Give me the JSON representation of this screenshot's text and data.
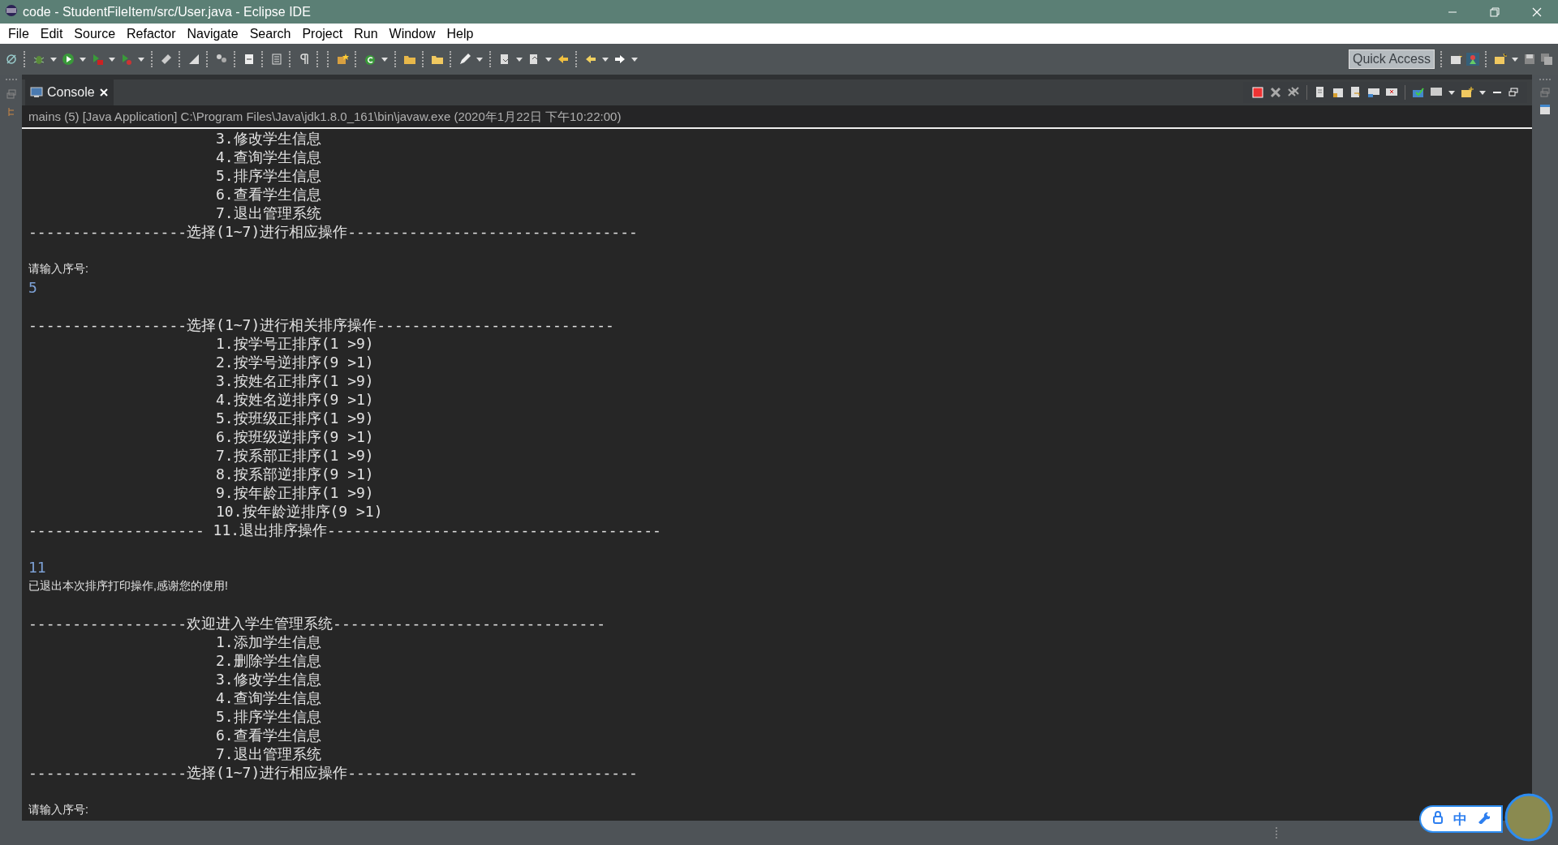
{
  "window": {
    "title": "code - StudentFileItem/src/User.java - Eclipse IDE"
  },
  "menu": [
    "File",
    "Edit",
    "Source",
    "Refactor",
    "Navigate",
    "Search",
    "Project",
    "Run",
    "Window",
    "Help"
  ],
  "quick_access": {
    "placeholder": "Quick Access"
  },
  "console": {
    "tab": {
      "label": "Console",
      "selected": true
    },
    "header": "mains (5) [Java Application] C:\\Program Files\\Java\\jdk1.8.0_161\\bin\\javaw.exe (2020年1月22日 下午10:22:00)",
    "lines": [
      {
        "kind": "item",
        "text": "3.修改学生信息"
      },
      {
        "kind": "item",
        "text": "4.查询学生信息"
      },
      {
        "kind": "item",
        "text": "5.排序学生信息"
      },
      {
        "kind": "item",
        "text": "6.查看学生信息"
      },
      {
        "kind": "item",
        "text": "7.退出管理系统"
      },
      {
        "kind": "rule",
        "text": "------------------选择(1~7)进行相应操作---------------------------------"
      },
      {
        "kind": "blank"
      },
      {
        "kind": "prompt",
        "text": "请输入序号:"
      },
      {
        "kind": "input",
        "text": "5"
      },
      {
        "kind": "blank"
      },
      {
        "kind": "rule",
        "text": "------------------选择(1~7)进行相关排序操作---------------------------"
      },
      {
        "kind": "item",
        "text": "1.按学号正排序(1 >9)"
      },
      {
        "kind": "item",
        "text": "2.按学号逆排序(9 >1)"
      },
      {
        "kind": "item",
        "text": "3.按姓名正排序(1 >9)"
      },
      {
        "kind": "item",
        "text": "4.按姓名逆排序(9 >1)"
      },
      {
        "kind": "item",
        "text": "5.按班级正排序(1 >9)"
      },
      {
        "kind": "item",
        "text": "6.按班级逆排序(9 >1)"
      },
      {
        "kind": "item",
        "text": "7.按系部正排序(1 >9)"
      },
      {
        "kind": "item",
        "text": "8.按系部逆排序(9 >1)"
      },
      {
        "kind": "item",
        "text": "9.按年龄正排序(1 >9)"
      },
      {
        "kind": "item",
        "text": "10.按年龄逆排序(9 >1)"
      },
      {
        "kind": "rule",
        "text": "-------------------- 11.退出排序操作--------------------------------------"
      },
      {
        "kind": "blank"
      },
      {
        "kind": "input",
        "text": "11"
      },
      {
        "kind": "prompt",
        "text": "已退出本次排序打印操作,感谢您的使用!"
      },
      {
        "kind": "blank"
      },
      {
        "kind": "rule",
        "text": "------------------欢迎进入学生管理系统-------------------------------"
      },
      {
        "kind": "item",
        "text": "1.添加学生信息"
      },
      {
        "kind": "item",
        "text": "2.删除学生信息"
      },
      {
        "kind": "item",
        "text": "3.修改学生信息"
      },
      {
        "kind": "item",
        "text": "4.查询学生信息"
      },
      {
        "kind": "item",
        "text": "5.排序学生信息"
      },
      {
        "kind": "item",
        "text": "6.查看学生信息"
      },
      {
        "kind": "item",
        "text": "7.退出管理系统"
      },
      {
        "kind": "rule",
        "text": "------------------选择(1~7)进行相应操作---------------------------------"
      },
      {
        "kind": "blank"
      },
      {
        "kind": "prompt",
        "text": "请输入序号:"
      }
    ]
  },
  "ime": {
    "label": "中"
  }
}
